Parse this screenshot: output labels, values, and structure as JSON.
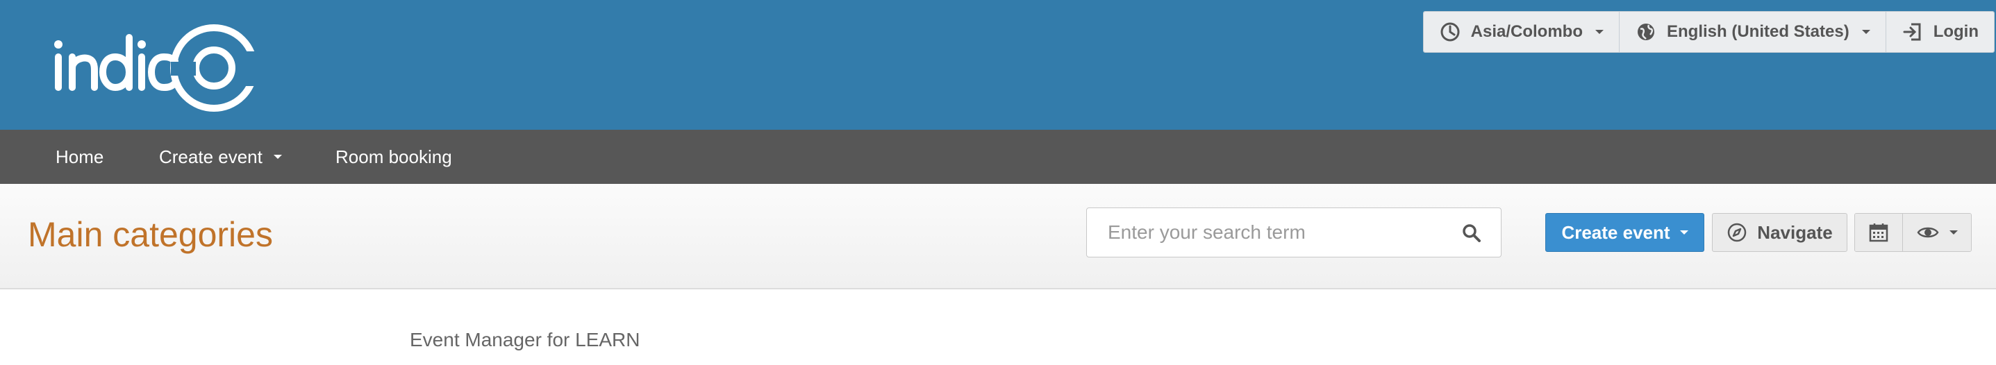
{
  "header": {
    "logo_text": "indico",
    "brand_color": "#337cab",
    "toolbar": {
      "timezone": "Asia/Colombo",
      "language": "English (United States)",
      "login": "Login",
      "icons": [
        "clock-icon",
        "globe-icon",
        "login-icon"
      ]
    }
  },
  "navbar": {
    "items": [
      {
        "label": "Home"
      },
      {
        "label": "Create event",
        "dropdown": true
      },
      {
        "label": "Room booking"
      }
    ]
  },
  "titlebar": {
    "title": "Main categories",
    "title_color": "#c0732a",
    "search": {
      "placeholder": "Enter your search term"
    },
    "create_event_label": "Create event",
    "create_event_color": "#3a8fd0",
    "navigate_label": "Navigate",
    "icons": [
      "search-icon",
      "compass-icon",
      "calendar-icon",
      "eye-icon"
    ]
  },
  "content": {
    "description": "Event Manager for LEARN"
  }
}
